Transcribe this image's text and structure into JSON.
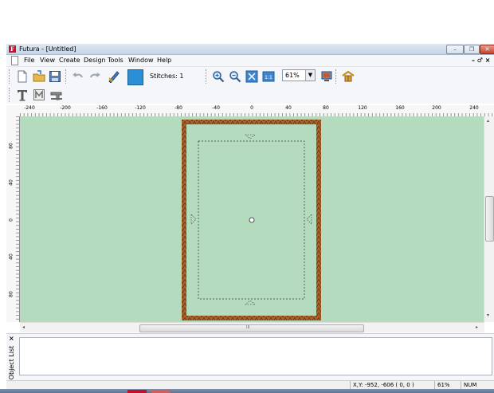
{
  "window": {
    "title": "Futura - [Untitled]",
    "logo_letter": "F",
    "min_glyph": "–",
    "max_glyph": "❐",
    "close_glyph": "✕"
  },
  "menubar": {
    "items": [
      "File",
      "View",
      "Create",
      "Design",
      "Tools",
      "Window",
      "Help"
    ],
    "mdi_controls": "– ♂ ×"
  },
  "toolbar": {
    "stitches_label": "Stitches: 1",
    "zoom_value": "61%",
    "zoom_arrow": "▼"
  },
  "icons": {
    "new": "new-document-icon",
    "open": "open-folder-icon",
    "save": "save-icon",
    "undo": "undo-icon",
    "redo": "redo-icon",
    "edit": "edit-design-icon",
    "color": "color-swatch-icon",
    "zoom_in": "zoom-in-icon",
    "zoom_out": "zoom-out-icon",
    "fit": "zoom-fit-icon",
    "actual": "actual-size-icon",
    "monitor": "monitor-icon",
    "hoop": "hoop-icon",
    "text": "text-tool-icon",
    "monogram": "monogram-icon",
    "machine": "sewing-machine-icon"
  },
  "colors": {
    "canvas": "#b4dbbe",
    "hoop_frame": "#a8642a",
    "swatch": "#2b8fd6",
    "close_button": "#c8402a"
  },
  "ruler": {
    "h_labels": [
      "-240",
      "-200",
      "-160",
      "-120",
      "-80",
      "-40",
      "0",
      "40",
      "80",
      "120",
      "160",
      "200",
      "240"
    ],
    "v_labels": [
      "80",
      "40",
      "0",
      "40",
      "80"
    ]
  },
  "scroll": {
    "left_arrow": "◂",
    "right_arrow": "▸",
    "up_arrow": "▴",
    "down_arrow": "▾",
    "h_grip": "III"
  },
  "object_panel": {
    "close_glyph": "×",
    "label": "Object List"
  },
  "status": {
    "coords": "X,Y: -952, -606  ( 0, 0 )",
    "zoom": "61%",
    "numlock": "NUM"
  }
}
